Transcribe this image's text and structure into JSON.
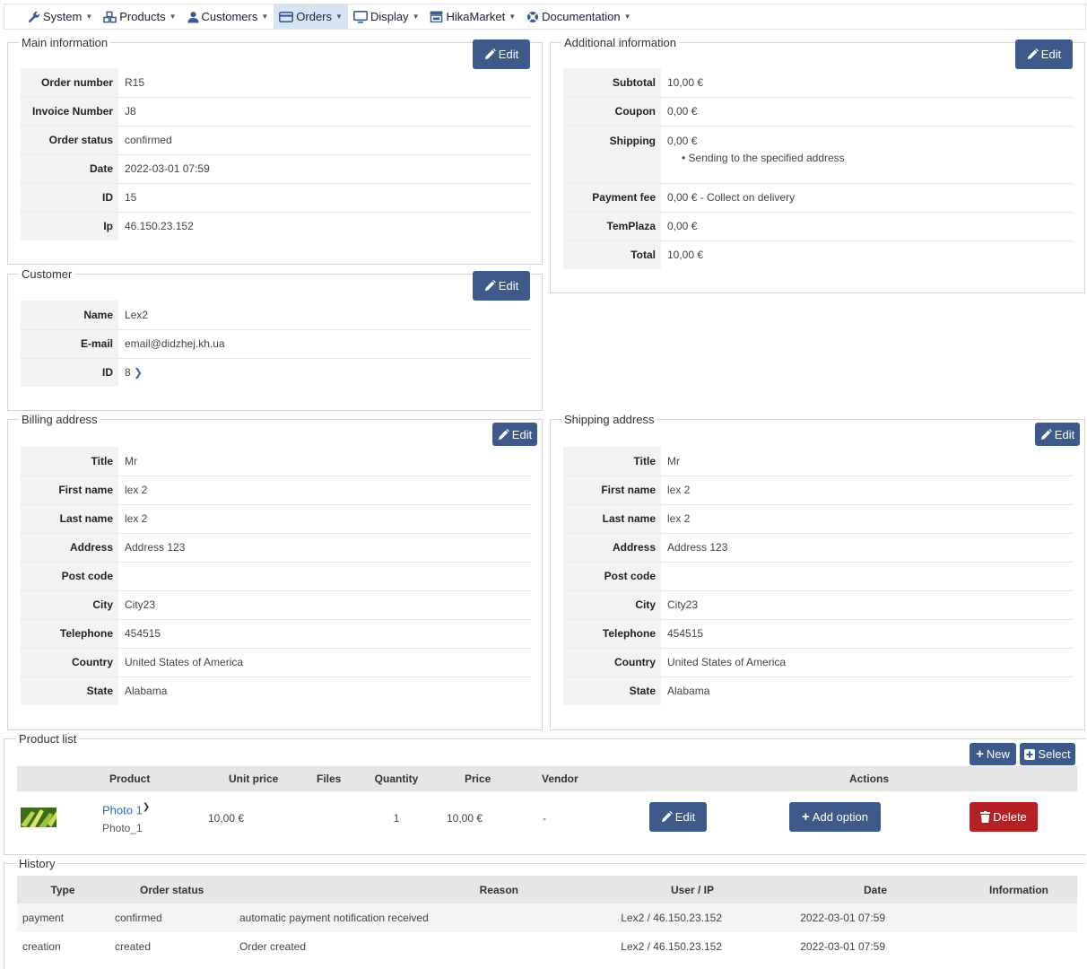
{
  "menu": [
    {
      "label": "System",
      "icon": "wrench-icon"
    },
    {
      "label": "Products",
      "icon": "cubes-icon"
    },
    {
      "label": "Customers",
      "icon": "user-icon"
    },
    {
      "label": "Orders",
      "icon": "credit-card-icon"
    },
    {
      "label": "Display",
      "icon": "monitor-icon"
    },
    {
      "label": "HikaMarket",
      "icon": "store-icon"
    },
    {
      "label": "Documentation",
      "icon": "lifebuoy-icon"
    }
  ],
  "edit_label": "Edit",
  "main_info": {
    "legend": "Main information",
    "rows": [
      {
        "k": "Order number",
        "v": "R15"
      },
      {
        "k": "Invoice Number",
        "v": "J8"
      },
      {
        "k": "Order status",
        "v": "confirmed"
      },
      {
        "k": "Date",
        "v": "2022-03-01 07:59"
      },
      {
        "k": "ID",
        "v": "15"
      },
      {
        "k": "Ip",
        "v": "46.150.23.152"
      }
    ]
  },
  "additional_info": {
    "legend": "Additional information",
    "subtotal_k": "Subtotal",
    "subtotal_v": "10,00 €",
    "coupon_k": "Coupon",
    "coupon_v": "0,00 €",
    "shipping_k": "Shipping",
    "shipping_v": "0,00 €",
    "shipping_note": "Sending to the specified address",
    "payment_k": "Payment fee",
    "payment_v": "0,00 € - Collect on delivery",
    "temp_k": "TemPlaza",
    "temp_v": "0,00 €",
    "total_k": "Total",
    "total_v": "10,00 €"
  },
  "customer": {
    "legend": "Customer",
    "name_k": "Name",
    "name_v": "Lex2",
    "email_k": "E-mail",
    "email_v": "email@didzhej.kh.ua",
    "id_k": "ID",
    "id_v": "8"
  },
  "billing": {
    "legend": "Billing address",
    "rows": [
      {
        "k": "Title",
        "v": "Mr"
      },
      {
        "k": "First name",
        "v": "lex 2"
      },
      {
        "k": "Last name",
        "v": "lex 2"
      },
      {
        "k": "Address",
        "v": "Address 123"
      },
      {
        "k": "Post code",
        "v": ""
      },
      {
        "k": "City",
        "v": "City23"
      },
      {
        "k": "Telephone",
        "v": "454515"
      },
      {
        "k": "Country",
        "v": "United States of America"
      },
      {
        "k": "State",
        "v": "Alabama"
      }
    ]
  },
  "shipping": {
    "legend": "Shipping address",
    "rows": [
      {
        "k": "Title",
        "v": "Mr"
      },
      {
        "k": "First name",
        "v": "lex 2"
      },
      {
        "k": "Last name",
        "v": "lex 2"
      },
      {
        "k": "Address",
        "v": "Address 123"
      },
      {
        "k": "Post code",
        "v": ""
      },
      {
        "k": "City",
        "v": "City23"
      },
      {
        "k": "Telephone",
        "v": "454515"
      },
      {
        "k": "Country",
        "v": "United States of America"
      },
      {
        "k": "State",
        "v": "Alabama"
      }
    ]
  },
  "products": {
    "legend": "Product list",
    "new_label": "New",
    "select_label": "Select",
    "headers": [
      "Product",
      "Unit price",
      "Files",
      "Quantity",
      "Price",
      "Vendor",
      "Actions"
    ],
    "item": {
      "name": "Photo 1",
      "code": "Photo_1",
      "unit_price": "10,00 €",
      "quantity": "1",
      "price": "10,00 €",
      "vendor": "-"
    },
    "edit_label": "Edit",
    "add_option_label": "Add option",
    "delete_label": "Delete"
  },
  "history": {
    "legend": "History",
    "headers": [
      "Type",
      "Order status",
      "Reason",
      "User / IP",
      "Date",
      "Information"
    ],
    "rows": [
      {
        "type": "payment",
        "status": "confirmed",
        "reason": "automatic payment notification received",
        "user": "Lex2 / 46.150.23.152",
        "date": "2022-03-01 07:59",
        "info": ""
      },
      {
        "type": "creation",
        "status": "created",
        "reason": "Order created",
        "user": "Lex2 / 46.150.23.152",
        "date": "2022-03-01 07:59",
        "info": ""
      }
    ]
  }
}
